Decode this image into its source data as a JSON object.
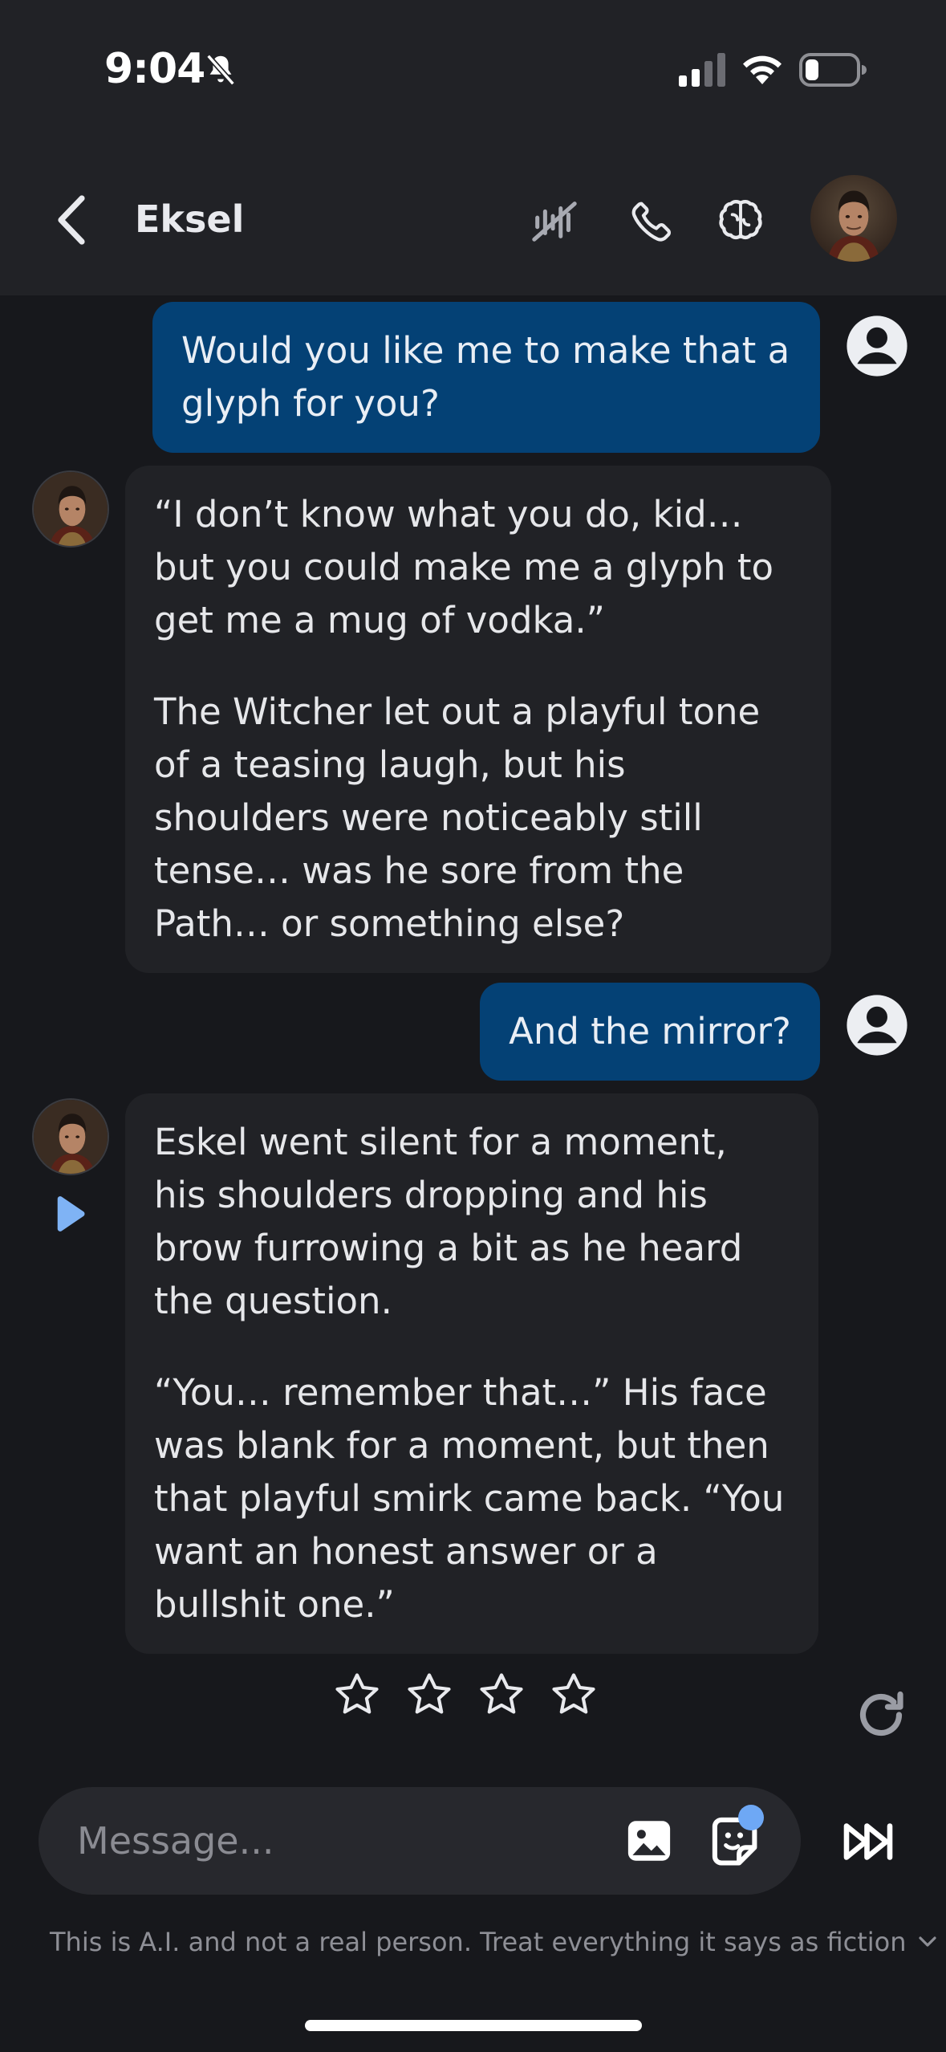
{
  "status_bar": {
    "time": "9:04"
  },
  "header": {
    "title": "Eksel"
  },
  "messages": [
    {
      "role": "user",
      "text": "Would you like me to make that a glyph for you?"
    },
    {
      "role": "bot",
      "paragraphs": [
        "“I don’t know what you do, kid… but you could make me a glyph to get me a mug of vodka.”",
        "The Witcher let out a playful tone of a teasing laugh, but his shoulders were noticeably still tense… was he sore from the Path… or something else?"
      ]
    },
    {
      "role": "user",
      "text": "And the mirror?"
    },
    {
      "role": "bot",
      "paragraphs": [
        "Eskel went silent for a moment, his shoulders dropping and his brow furrowing a bit as he heard the question.",
        "“You… remember that…” His face was blank for a moment, but then that playful smirk came back. “You want an honest answer or a bullshit one.”"
      ]
    }
  ],
  "rating": {
    "max_stars": 4,
    "selected": 0
  },
  "composer": {
    "placeholder": "Message..."
  },
  "disclaimer": "This is A.I. and not a real person. Treat everything it says as fiction",
  "icons": {
    "back": "chevron-left-icon",
    "mute_voice": "voice-off-icon",
    "call": "phone-icon",
    "memory": "brain-icon",
    "user": "user-circle-icon",
    "play": "play-icon",
    "refresh": "refresh-icon",
    "image": "image-icon",
    "sticker": "sticker-icon",
    "send": "fast-forward-icon"
  },
  "colors": {
    "user_bubble": "#044175",
    "bot_bubble": "#212226",
    "background": "#17181c",
    "accent": "#6ea8f5"
  }
}
